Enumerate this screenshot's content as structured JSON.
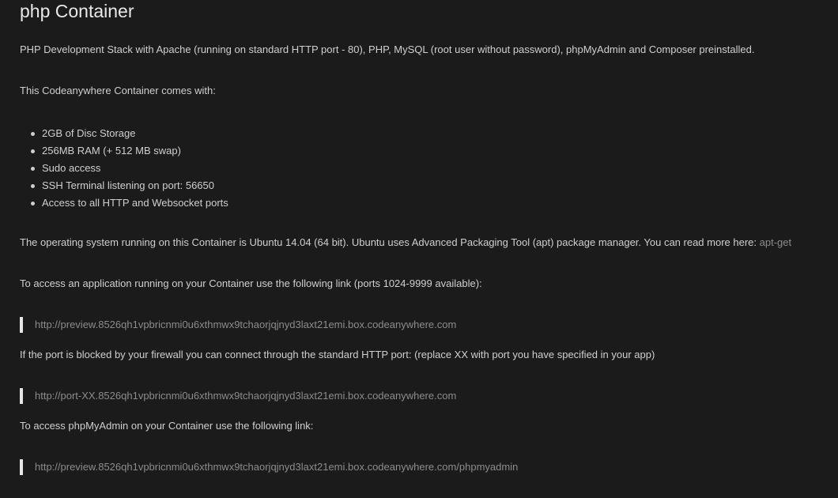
{
  "header": {
    "title": "php Container"
  },
  "intro": {
    "description": "PHP Development Stack with Apache (running on standard HTTP port - 80), PHP, MySQL (root user without password), phpMyAdmin and Composer preinstalled.",
    "comes_with": "This Codeanywhere Container comes with:"
  },
  "features": [
    "2GB of Disc Storage",
    "256MB RAM (+ 512 MB swap)",
    "Sudo access",
    "SSH Terminal listening on port: 56650",
    "Access to all HTTP and Websocket ports"
  ],
  "os": {
    "text": "The operating system running on this Container is Ubuntu 14.04 (64 bit). Ubuntu uses Advanced Packaging Tool (apt) package manager. You can read more here: ",
    "link_label": "apt-get"
  },
  "access": {
    "app_intro": "To access an application running on your Container use the following link (ports 1024-9999 available):",
    "preview_link": "http://preview.8526qh1vpbricnmi0u6xthmwx9tchaorjqjnyd3laxt21emi.box.codeanywhere.com",
    "firewall_note": "If the port is blocked by your firewall you can connect through the standard HTTP port: (replace XX with port you have specified in your app)",
    "port_link": "http://port-XX.8526qh1vpbricnmi0u6xthmwx9tchaorjqjnyd3laxt21emi.box.codeanywhere.com",
    "phpmyadmin_intro": "To access phpMyAdmin on your Container use the following link:",
    "phpmyadmin_link": "http://preview.8526qh1vpbricnmi0u6xthmwx9tchaorjqjnyd3laxt21emi.box.codeanywhere.com/phpmyadmin"
  },
  "colors": {
    "background": "#1b1b1b",
    "text": "#cfcfcf",
    "link": "#8c8c8c",
    "quote_bar": "#e6e6e6"
  }
}
